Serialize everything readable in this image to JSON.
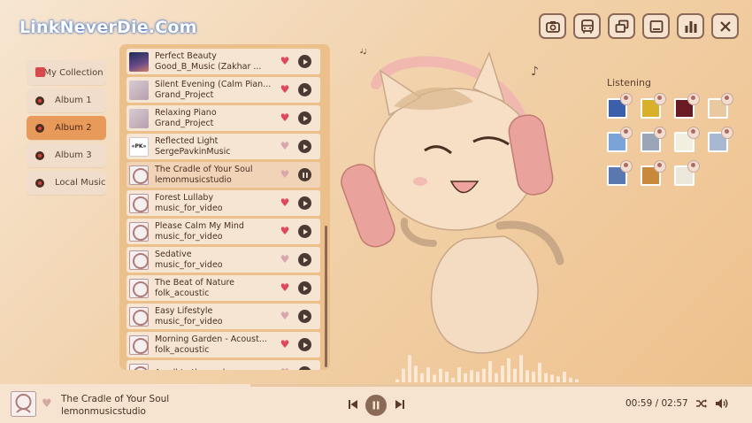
{
  "watermark": "LinkNeverDie.Com",
  "toolbar": [
    {
      "name": "camera-button",
      "icon": "camera-icon"
    },
    {
      "name": "bus-button",
      "icon": "bus-icon"
    },
    {
      "name": "windows-button",
      "icon": "overlapping-windows-icon"
    },
    {
      "name": "minimize-button",
      "icon": "minimize-icon"
    },
    {
      "name": "stats-button",
      "icon": "bar-chart-icon"
    },
    {
      "name": "close-button",
      "icon": "close-icon"
    }
  ],
  "sidebar": {
    "items": [
      {
        "label": "My Collection",
        "active": false
      },
      {
        "label": "Album 1",
        "active": false
      },
      {
        "label": "Album 2",
        "active": true
      },
      {
        "label": "Album 3",
        "active": false
      },
      {
        "label": "Local Music",
        "active": false
      }
    ]
  },
  "playlist": {
    "tracks": [
      {
        "title": "Perfect Beauty",
        "artist": "Good_B_Music (Zakhar ...",
        "liked": true,
        "thumb": "space",
        "playing": false
      },
      {
        "title": "Silent Evening (Calm Pian...",
        "artist": "Grand_Project",
        "liked": true,
        "thumb": "piano",
        "playing": false
      },
      {
        "title": "Relaxing Piano",
        "artist": "Grand_Project",
        "liked": true,
        "thumb": "piano",
        "playing": false
      },
      {
        "title": "Reflected Light",
        "artist": "SergePavkinMusic",
        "liked": false,
        "thumb": "logo",
        "playing": false
      },
      {
        "title": "The Cradle of Your Soul",
        "artist": "lemonmusicstudio",
        "liked": false,
        "thumb": "girl",
        "playing": true
      },
      {
        "title": "Forest Lullaby",
        "artist": "music_for_video",
        "liked": true,
        "thumb": "girl",
        "playing": false
      },
      {
        "title": "Please Calm My Mind",
        "artist": "music_for_video",
        "liked": true,
        "thumb": "girl",
        "playing": false
      },
      {
        "title": "Sedative",
        "artist": "music_for_video",
        "liked": false,
        "thumb": "girl",
        "playing": false
      },
      {
        "title": "The Beat of Nature",
        "artist": "folk_acoustic",
        "liked": true,
        "thumb": "girl",
        "playing": false
      },
      {
        "title": "Easy Lifestyle",
        "artist": "music_for_video",
        "liked": false,
        "thumb": "girl",
        "playing": false
      },
      {
        "title": "Morning Garden - Acoust...",
        "artist": "folk_acoustic",
        "liked": true,
        "thumb": "girl",
        "playing": false
      },
      {
        "title": "A call to the soul",
        "artist": "",
        "liked": false,
        "thumb": "girl",
        "playing": false
      }
    ],
    "logo_thumb_text": "«PK»"
  },
  "listening": {
    "title": "Listening",
    "avatars": [
      {
        "color": "#3b5fa8"
      },
      {
        "color": "#d8b02a"
      },
      {
        "color": "#6a1a22"
      },
      {
        "color": "#e8c9a0"
      },
      {
        "color": "#7aa4d8"
      },
      {
        "color": "#9aa6b8"
      },
      {
        "color": "#f2eee0"
      },
      {
        "color": "#a8b8d0"
      },
      {
        "color": "#5a78b0"
      },
      {
        "color": "#c88a3a"
      },
      {
        "color": "#ede6da"
      }
    ]
  },
  "now_playing": {
    "title": "The Cradle of Your Soul",
    "artist": "lemonmusicstudio",
    "current_time": "00:59",
    "total_time": "02:57",
    "time_display": "00:59 / 02:57",
    "progress": 0.333
  },
  "visualizer": {
    "levels": [
      0.1,
      0.45,
      0.9,
      0.55,
      0.3,
      0.5,
      0.25,
      0.45,
      0.35,
      0.15,
      0.5,
      0.3,
      0.4,
      0.35,
      0.45,
      0.7,
      0.3,
      0.55,
      0.8,
      0.45,
      0.9,
      0.4,
      0.35,
      0.65,
      0.3,
      0.25,
      0.2,
      0.35,
      0.15,
      0.1
    ]
  },
  "colors": {
    "accent": "#e79a5a",
    "heart_on": "#e0475a",
    "heart_off": "#d8a8ad",
    "panel": "#ecc08b"
  }
}
